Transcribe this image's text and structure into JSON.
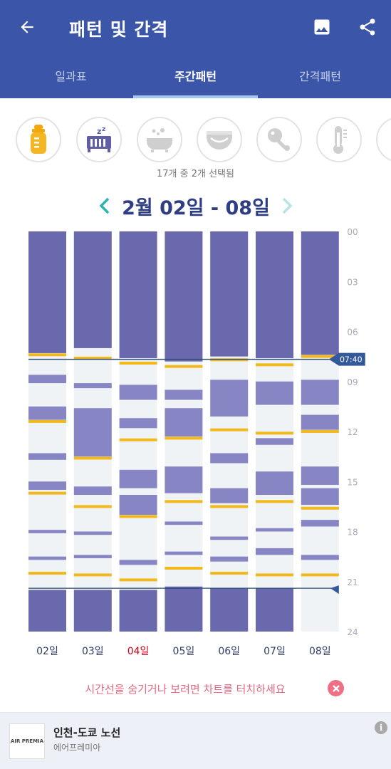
{
  "header": {
    "title": "패턴 및 간격",
    "back_icon": "arrow-back-icon",
    "image_icon": "image-icon",
    "share_icon": "share-icon"
  },
  "tabs": [
    {
      "label": "일과표",
      "active": false
    },
    {
      "label": "주간패턴",
      "active": true
    },
    {
      "label": "간격패턴",
      "active": false
    }
  ],
  "categories": [
    {
      "icon": "baby-bottle-icon",
      "selected": true
    },
    {
      "icon": "crib-sleep-icon",
      "selected": true
    },
    {
      "icon": "bathtub-icon",
      "selected": false
    },
    {
      "icon": "diaper-icon",
      "selected": false
    },
    {
      "icon": "rattle-icon",
      "selected": false
    },
    {
      "icon": "thermometer-icon",
      "selected": false
    },
    {
      "icon": "more-category-icon",
      "selected": false
    }
  ],
  "selected_count": "17개 중 2개 선택됨",
  "week": {
    "label": "2월 02일 - 08일",
    "prev_icon": "chevron-left-icon",
    "next_icon": "chevron-right-icon"
  },
  "colors": {
    "header": "#3b56a8",
    "sleep": "#6a69ad",
    "nap": "#8885c4",
    "feed": "#f2b91c",
    "day_bg": "#eff3f6",
    "now_line": "#2b4c73",
    "today_label": "#d0021b",
    "hint": "#e8677f"
  },
  "chart_data": {
    "type": "timeline",
    "y_ticks": [
      "00",
      "03",
      "06",
      "09",
      "12",
      "15",
      "18",
      "21",
      "24"
    ],
    "ylim": [
      0,
      24
    ],
    "current_time_label": "07:40",
    "current_time": 7.67,
    "sleep_start_time": 21.4,
    "today_index": 2,
    "days": [
      {
        "label": "02일",
        "sleep": [
          [
            0,
            7.3
          ],
          [
            21.5,
            24
          ]
        ],
        "naps": [
          [
            8.6,
            9.1
          ],
          [
            10.5,
            11.3
          ],
          [
            13.3,
            13.7
          ],
          [
            15.0,
            15.5
          ],
          [
            17.9,
            18.1
          ],
          [
            19.5,
            19.7
          ]
        ],
        "feeds": [
          7.4,
          11.4,
          15.7,
          20.5
        ]
      },
      {
        "label": "03일",
        "sleep": [
          [
            0,
            7.0
          ],
          [
            21.5,
            24
          ]
        ],
        "naps": [
          [
            9.1,
            9.4
          ],
          [
            10.6,
            13.5
          ],
          [
            15.3,
            15.8
          ],
          [
            18.0,
            18.2
          ],
          [
            19.4,
            19.6
          ]
        ],
        "feeds": [
          7.6,
          13.6,
          16.5,
          20.6
        ]
      },
      {
        "label": "04일",
        "sleep": [
          [
            0,
            7.6
          ],
          [
            21.5,
            24
          ]
        ],
        "naps": [
          [
            9.2,
            10.1
          ],
          [
            11.2,
            11.8
          ],
          [
            14.3,
            15.4
          ],
          [
            15.8,
            17.0
          ],
          [
            19.7,
            20.0
          ]
        ],
        "feeds": [
          7.9,
          12.5,
          17.1,
          20.9
        ]
      },
      {
        "label": "05일",
        "sleep": [
          [
            0,
            7.8
          ],
          [
            21.3,
            24
          ]
        ],
        "naps": [
          [
            9.5,
            10.1
          ],
          [
            10.6,
            12.3
          ],
          [
            14.1,
            15.7
          ],
          [
            17.4,
            17.6
          ],
          [
            19.2,
            19.4
          ]
        ],
        "feeds": [
          8.1,
          12.4,
          16.2,
          20.2
        ]
      },
      {
        "label": "06일",
        "sleep": [
          [
            0,
            7.5
          ],
          [
            21.4,
            24
          ]
        ],
        "naps": [
          [
            8.9,
            11.1
          ],
          [
            13.3,
            13.9
          ],
          [
            15.4,
            16.3
          ],
          [
            18.3,
            18.5
          ],
          [
            19.5,
            19.8
          ]
        ],
        "feeds": [
          7.7,
          11.9,
          16.5,
          20.5
        ]
      },
      {
        "label": "07일",
        "sleep": [
          [
            0,
            7.6
          ],
          [
            21.4,
            24
          ]
        ],
        "naps": [
          [
            9.0,
            10.4
          ],
          [
            12.4,
            12.8
          ],
          [
            14.4,
            15.8
          ],
          [
            17.8,
            18.0
          ],
          [
            19.0,
            19.4
          ]
        ],
        "feeds": [
          8.0,
          12.1,
          16.2,
          20.6
        ]
      },
      {
        "label": "08일",
        "sleep": [
          [
            0,
            7.4
          ]
        ],
        "naps": [
          [
            8.9,
            10.4
          ],
          [
            11.0,
            11.9
          ],
          [
            14.1,
            15.2
          ],
          [
            15.4,
            16.4
          ],
          [
            17.3,
            17.7
          ],
          [
            19.4,
            19.7
          ]
        ],
        "feeds": [
          7.5,
          12.0,
          16.6,
          20.6
        ]
      }
    ]
  },
  "hint": {
    "text": "시간선을 숨기거나 보려면 차트를 터치하세요",
    "close_icon": "close-icon"
  },
  "ad": {
    "title": "인천-도쿄 노선",
    "subtitle": "에어프레미아",
    "logo_text": "AIR PREMIA",
    "info_icon": "info-icon"
  }
}
